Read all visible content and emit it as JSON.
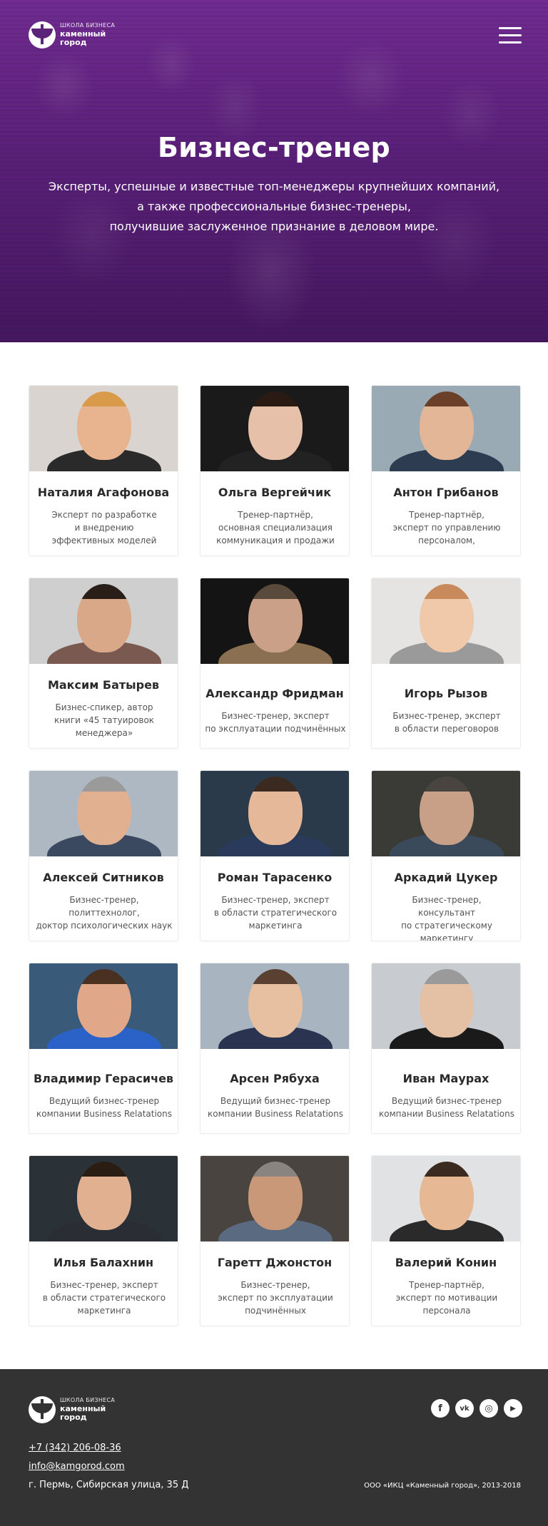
{
  "brand": {
    "small": "ШКОЛА БИЗНЕСА",
    "line1": "каменный",
    "line2": "город"
  },
  "hero": {
    "title": "Бизнес-тренер",
    "subtitle_lines": [
      "Эксперты, успешные и известные топ-менеджеры крупнейших компаний,",
      "а также профессиональные бизнес-тренеры,",
      "получившие заслуженное признание в деловом мире."
    ]
  },
  "trainers": [
    {
      "name": "Наталия Агафонова",
      "desc": [
        "Эксперт по разработке",
        "и внедрению",
        "эффективных моделей"
      ]
    },
    {
      "name": "Ольга Вергейчик",
      "desc": [
        "Тренер-партнёр,",
        "основная специализация",
        "коммуникация и продажи"
      ]
    },
    {
      "name": "Антон Грибанов",
      "desc": [
        "Тренер-партнёр,",
        "эксперт по управлению",
        "персоналом,"
      ]
    },
    {
      "name": "Максим Батырев",
      "desc": [
        "Бизнес-спикер, автор",
        "книги «45 татуировок",
        "менеджера»"
      ]
    },
    {
      "name": "Александр Фридман",
      "desc": [
        "Бизнес-тренер, эксперт",
        "по эксплуатации подчинённых"
      ]
    },
    {
      "name": "Игорь Рызов",
      "desc": [
        "Бизнес-тренер, эксперт",
        "в области переговоров"
      ]
    },
    {
      "name": "Алексей Ситников",
      "desc": [
        "Бизнес-тренер,",
        "политтехнолог,",
        "доктор психологических наук"
      ]
    },
    {
      "name": "Роман Тарасенко",
      "desc": [
        "Бизнес-тренер, эксперт",
        "в области стратегического",
        "маркетинга"
      ]
    },
    {
      "name": "Аркадий Цукер",
      "desc": [
        "Бизнес-тренер,",
        "консультант",
        "по стратегическому маркетингу"
      ]
    },
    {
      "name": "Владимир Герасичев",
      "desc": [
        "Ведущий бизнес-тренер",
        "компании Business Relatations"
      ]
    },
    {
      "name": "Арсен Рябуха",
      "desc": [
        "Ведущий бизнес-тренер",
        "компании Business Relatations"
      ]
    },
    {
      "name": "Иван Маурах",
      "desc": [
        "Ведущий бизнес-тренер",
        "компании Business Relatations"
      ]
    },
    {
      "name": "Илья Балахнин",
      "desc": [
        "Бизнес-тренер, эксперт",
        "в области стратегического",
        "маркетинга"
      ]
    },
    {
      "name": "Гаретт Джонстон",
      "desc": [
        "Бизнес-тренер,",
        "эксперт по эксплуатации",
        "подчинённых"
      ]
    },
    {
      "name": "Валерий Конин",
      "desc": [
        "Тренер-партнёр,",
        "эксперт по мотивации",
        "персонала"
      ]
    }
  ],
  "photo_styles": [
    {
      "bg": "#d9d4d0",
      "head": "#e8b48f",
      "hair": "#d99a4a",
      "body": "#2a2a2a"
    },
    {
      "bg": "#1a1a1a",
      "head": "#e6c0a8",
      "hair": "#2a1a14",
      "body": "#222222"
    },
    {
      "bg": "#9aaab5",
      "head": "#e2b696",
      "hair": "#6a4028",
      "body": "#2e3c52"
    },
    {
      "bg": "#cfcfcf",
      "head": "#d8a888",
      "hair": "#2a1e18",
      "body": "#7a5a50"
    },
    {
      "bg": "#141414",
      "head": "#caa088",
      "hair": "#5a4a3c",
      "body": "#8a7050"
    },
    {
      "bg": "#e6e4e2",
      "head": "#f0c8aa",
      "hair": "#c88a5a",
      "body": "#9a9a9a"
    },
    {
      "bg": "#aeb8c2",
      "head": "#e0b090",
      "hair": "#9a9a9a",
      "body": "#3a4860"
    },
    {
      "bg": "#2a3a4a",
      "head": "#e4b898",
      "hair": "#3a2a20",
      "body": "#2a3a5a"
    },
    {
      "bg": "#3a3a36",
      "head": "#c8a088",
      "hair": "#4a4440",
      "body": "#3a4a5a"
    },
    {
      "bg": "#3a5a7a",
      "head": "#e0a888",
      "hair": "#4a3020",
      "body": "#2a62c8"
    },
    {
      "bg": "#a8b4c0",
      "head": "#e6c0a0",
      "hair": "#5a4030",
      "body": "#2a3450"
    },
    {
      "bg": "#c8ccd0",
      "head": "#e4c0a4",
      "hair": "#9a9a9a",
      "body": "#1a1a1a"
    },
    {
      "bg": "#2a3238",
      "head": "#e0b090",
      "hair": "#2a1e14",
      "body": "#2a2e34"
    },
    {
      "bg": "#4a4440",
      "head": "#c89878",
      "hair": "#8a8480",
      "body": "#5a6a80"
    },
    {
      "bg": "#e0e2e4",
      "head": "#e6b894",
      "hair": "#3a2a20",
      "body": "#2a2a2a"
    }
  ],
  "footer": {
    "brand": {
      "small": "ШКОЛА БИЗНЕСА",
      "line1": "каменный",
      "line2": "город"
    },
    "phone": "+7 (342) 206-08-36",
    "email": "info@kamgorod.com",
    "address": "г. Пермь, Сибирская улица, 35 Д",
    "copyright": "ООО «ИКЦ «Каменный город», 2013-2018",
    "social": [
      {
        "name": "facebook",
        "glyph": "f"
      },
      {
        "name": "vk",
        "glyph": "vk"
      },
      {
        "name": "instagram",
        "glyph": "◎"
      },
      {
        "name": "youtube",
        "glyph": "▶"
      }
    ]
  }
}
